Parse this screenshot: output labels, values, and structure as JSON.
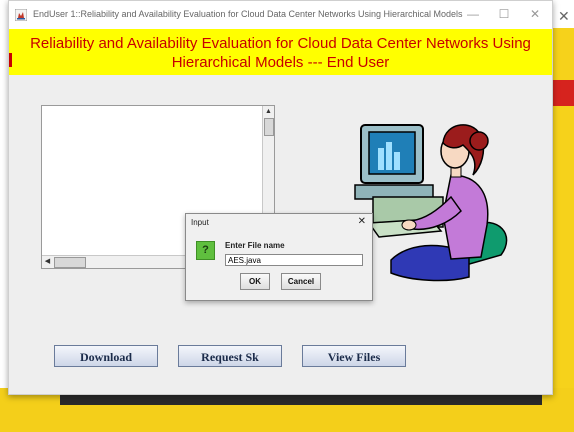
{
  "window": {
    "title": "EndUser 1::Reliability and Availability Evaluation for Cloud Data Center Networks Using Hierarchical Models",
    "minimize": "—",
    "maximize": "☐",
    "close": "✕"
  },
  "background_window": {
    "close": "✕"
  },
  "banner": {
    "line1": "Reliability and Availability Evaluation for Cloud Data Center Networks Using",
    "line2": "Hierarchical Models ---  End User"
  },
  "buttons": {
    "download": "Download",
    "request_sk": "Request Sk",
    "view_files": "View Files"
  },
  "dialog": {
    "title": "Input",
    "close": "✕",
    "question_icon": "?",
    "label": "Enter File name",
    "input_value": "AES.java",
    "ok": "OK",
    "cancel": "Cancel"
  },
  "icons": {
    "app": "java-app-icon",
    "illustration": "woman-at-computer-illustration"
  },
  "colors": {
    "banner_bg": "#ffff00",
    "banner_text": "#c80000",
    "content_bg": "#eeeeee",
    "question_icon": "#5fbf3e"
  }
}
